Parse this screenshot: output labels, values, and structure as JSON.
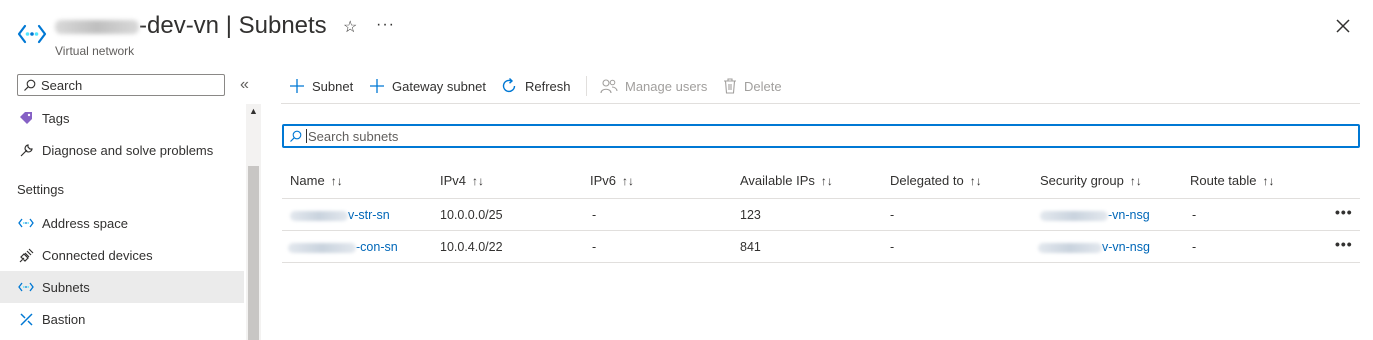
{
  "header": {
    "title_suffix": "-dev-vn",
    "title_sep": " | ",
    "title_page": "Subnets",
    "subtitle": "Virtual network",
    "favorite_icon": "star-icon",
    "more_icon": "ellipsis-icon",
    "close_icon": "close-icon"
  },
  "sidebar": {
    "search_placeholder": "Search",
    "collapse_icon": "double-chevron-left-icon",
    "items_top": [
      {
        "label": "Tags",
        "icon": "tag-icon"
      },
      {
        "label": "Diagnose and solve problems",
        "icon": "wrench-icon"
      }
    ],
    "section_header": "Settings",
    "items_settings": [
      {
        "label": "Address space",
        "icon": "vnet-icon"
      },
      {
        "label": "Connected devices",
        "icon": "plug-icon"
      },
      {
        "label": "Subnets",
        "icon": "vnet-icon",
        "active": true
      },
      {
        "label": "Bastion",
        "icon": "bastion-icon"
      }
    ]
  },
  "toolbar": {
    "subnet": "Subnet",
    "gateway_subnet": "Gateway subnet",
    "refresh": "Refresh",
    "manage_users": "Manage users",
    "delete": "Delete"
  },
  "grid": {
    "search_placeholder": "Search subnets",
    "sort_glyph": "↑↓",
    "columns": [
      "Name",
      "IPv4",
      "IPv6",
      "Available IPs",
      "Delegated to",
      "Security group",
      "Route table"
    ],
    "rows": [
      {
        "name": "v-str-sn",
        "ipv4": "10.0.0.0/25",
        "ipv6": "-",
        "available_ips": "123",
        "delegated_to": "-",
        "security_group": "-vn-nsg",
        "route_table": "-",
        "more": "•••"
      },
      {
        "name": "-con-sn",
        "ipv4": "10.0.4.0/22",
        "ipv6": "-",
        "available_ips": "841",
        "delegated_to": "-",
        "security_group": "v-vn-nsg",
        "route_table": "-",
        "more": "•••"
      }
    ]
  },
  "colors": {
    "accent": "#0078d4",
    "link": "#0067b8",
    "active_bg": "#ebebeb"
  }
}
